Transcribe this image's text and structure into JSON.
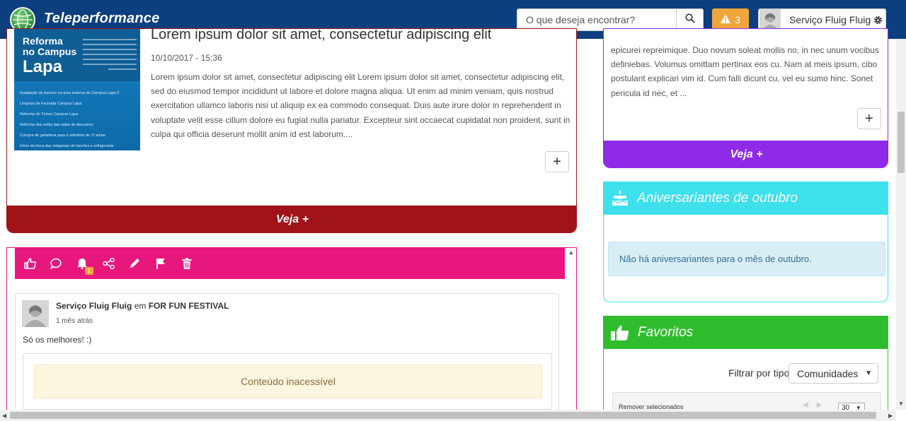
{
  "header": {
    "brand": "Teleperformance",
    "search": {
      "placeholder": "O que deseja encontrar?"
    },
    "alerts": {
      "count": "3"
    },
    "user": {
      "name": "Serviço Fluig Fluig"
    }
  },
  "post1": {
    "image": {
      "title_line1": "Reforma",
      "title_line2": "no Campus",
      "title_line3": "Lapa",
      "items": [
        "Instalação de bancos na área externa do Campus Lapa II",
        "Limpeza da Fachada Campus Lapa",
        "Reforma do Térreo Campus Lapa",
        "Reforma dos sofás das salas de descanso",
        "Compra de geladeira para o refeitório do 1º andar",
        "Início da troca das máquinas de lanches e refrigerante"
      ]
    },
    "title": "Lorem ipsum dolor sit amet, consectetur adipiscing elit",
    "date": "10/10/2017 - 15:36",
    "text": "Lorem ipsum dolor sit amet, consectetur adipiscing elit Lorem ipsum dolor sit amet, consectetur adipiscing elit, sed do eiusmod tempor incididunt ut labore et dolore magna aliqua. Ut enim ad minim veniam, quis nostrud exercitation ullamco laboris nisi ut aliquip ex ea commodo consequat. Duis aute irure dolor in reprehenderit in voluptate velit esse cillum dolore eu fugiat nulla pariatur. Excepteur sint occaecat cupidatat non proident, sunt in culpa qui officia deserunt mollit anim id est laborum....",
    "plus": "+",
    "more": "Veja +"
  },
  "post2": {
    "toolbar": {
      "notification_badge": "1"
    },
    "comment": {
      "author": "Serviço Fluig Fluig",
      "connector": "em",
      "community": "FOR FUN FESTIVAL",
      "time": "1 mês atrás",
      "text": "Só os melhores! :)",
      "inaccessible": "Conteúdo inacessível"
    }
  },
  "sidebar": {
    "news": {
      "text": "epicurei repreimique. Duo novum soleat mollis no, in nec unum vocibus definiebas. Volumus omittam pertinax eos cu. Nam at meis ipsum, cibo postulant explicari vim id. Cum falli dicunt cu, vel eu sumo hinc. Sonet pericula id nec, et ...",
      "plus": "+",
      "more": "Veja +"
    },
    "birthdays": {
      "title": "Aniversariantes de outubro",
      "empty": "Não há aniversariantes para o mês de outubro."
    },
    "favorites": {
      "title": "Favoritos",
      "filter_label": "Filtrar por tipo",
      "filter_value": "Comunidades",
      "remove_selected": "Remover selecionados",
      "page_size": "30"
    }
  },
  "colors": {
    "header": "#0c3f7f",
    "post1_accent": "#a01419",
    "post2_accent": "#e8177e",
    "news_accent": "#8f2ae8",
    "birthdays_accent": "#3ee0ec",
    "favorites_accent": "#2fbd2e",
    "alert": "#f0a63c"
  },
  "icons": [
    "search-icon",
    "warning-icon",
    "gear-icon",
    "like-icon",
    "comment-icon",
    "bell-icon",
    "share-icon",
    "edit-icon",
    "flag-icon",
    "trash-icon",
    "cake-icon",
    "thumbs-up-icon"
  ]
}
